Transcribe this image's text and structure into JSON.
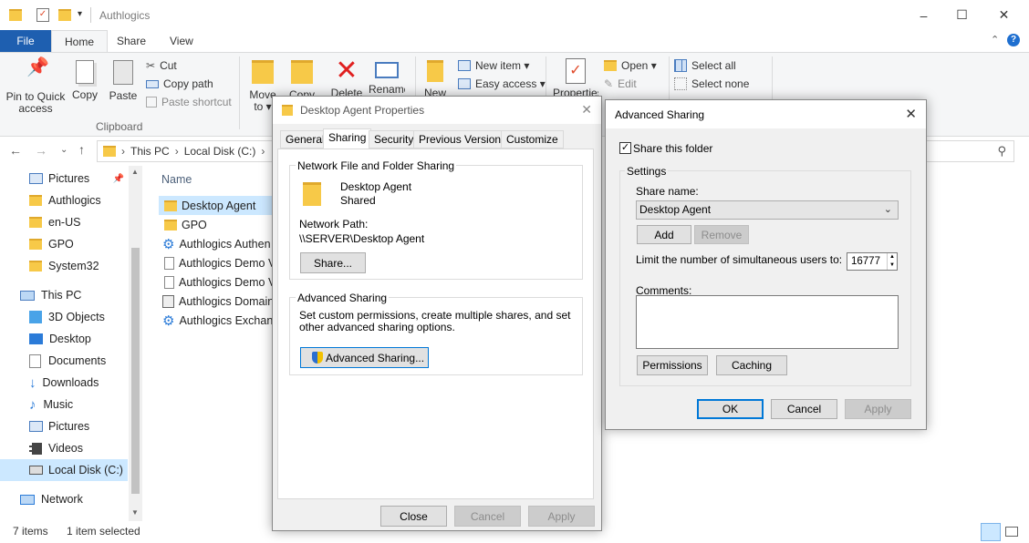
{
  "window": {
    "title": "Authlogics",
    "min": "–",
    "max": "☐",
    "close": "✕"
  },
  "tabs": [
    "File",
    "Home",
    "Share",
    "View"
  ],
  "ribbon": {
    "pin": "Pin to Quick access",
    "copy": "Copy",
    "paste": "Paste",
    "cut": "Cut",
    "copy_path": "Copy path",
    "paste_shortcut": "Paste shortcut",
    "clipboard": "Clipboard",
    "move_to": "Move to ▾",
    "copy_to": "Copy",
    "delete": "Delete",
    "rename": "Rename",
    "new_folder": "New",
    "new_item": "New item ▾",
    "easy_access": "Easy access ▾",
    "properties": "Properties",
    "open": "Open ▾",
    "edit": "Edit",
    "select_all": "Select all",
    "select_none": "Select none"
  },
  "address": {
    "this_pc": "This PC",
    "disk": "Local Disk (C:)",
    "sep": "›"
  },
  "nav": [
    "Pictures",
    "Authlogics",
    "en-US",
    "GPO",
    "System32",
    "This PC",
    "3D Objects",
    "Desktop",
    "Documents",
    "Downloads",
    "Music",
    "Pictures",
    "Videos",
    "Local Disk (C:)",
    "Network"
  ],
  "files": {
    "header": "Name",
    "rows": [
      "Desktop Agent",
      "GPO",
      "Authlogics Authen",
      "Authlogics Demo V",
      "Authlogics Demo V",
      "Authlogics Domain",
      "Authlogics Exchang"
    ]
  },
  "status": {
    "count": "7 items",
    "selected": "1 item selected"
  },
  "props": {
    "title": "Desktop Agent Properties",
    "tabs": [
      "General",
      "Sharing",
      "Security",
      "Previous Versions",
      "Customize"
    ],
    "nfs_caption": "Network File and Folder Sharing",
    "folder_name": "Desktop Agent",
    "folder_state": "Shared",
    "network_path_label": "Network Path:",
    "network_path": "\\\\SERVER\\Desktop Agent",
    "share_btn": "Share...",
    "adv_caption": "Advanced Sharing",
    "adv_desc": "Set custom permissions, create multiple shares, and set other advanced sharing options.",
    "adv_btn": "Advanced Sharing...",
    "close": "Close",
    "cancel": "Cancel",
    "apply": "Apply"
  },
  "adv": {
    "title": "Advanced Sharing",
    "share_folder": "Share this folder",
    "settings": "Settings",
    "share_name_label": "Share name:",
    "share_name": "Desktop Agent",
    "add": "Add",
    "remove": "Remove",
    "limit_label": "Limit the number of simultaneous users to:",
    "limit_value": "16777",
    "comments_label": "Comments:",
    "permissions": "Permissions",
    "caching": "Caching",
    "ok": "OK",
    "cancel": "Cancel",
    "apply": "Apply"
  }
}
